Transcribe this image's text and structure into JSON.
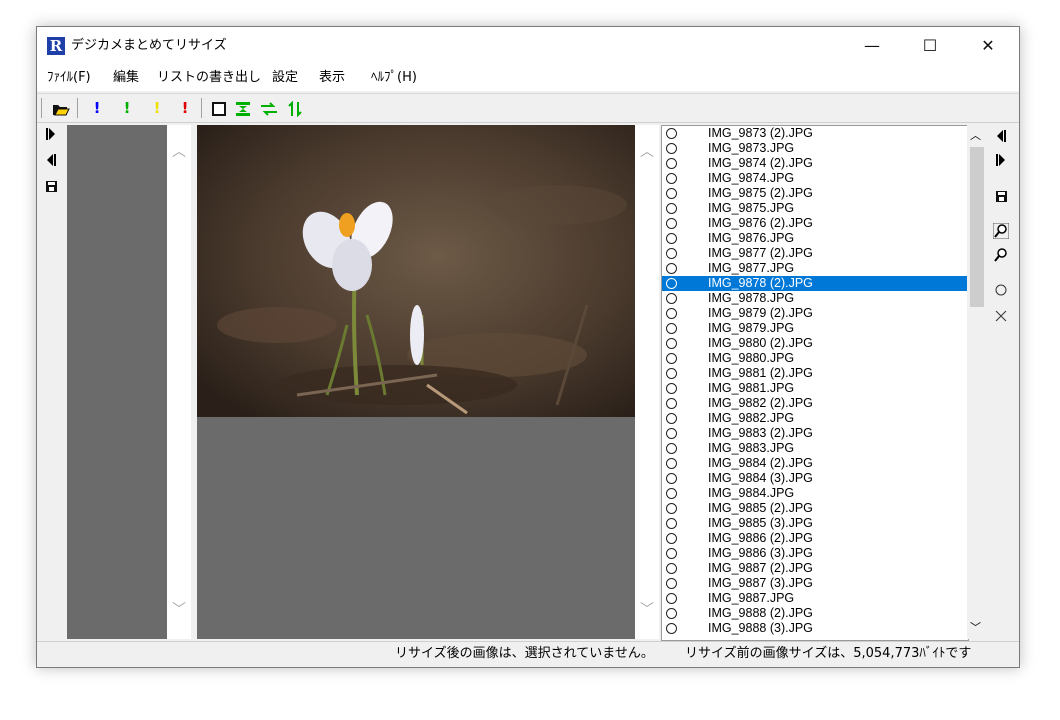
{
  "window": {
    "title": "デジカメまとめてリサイズ",
    "icon_letter": "R",
    "minimize": "—",
    "maximize": "☐",
    "close": "✕"
  },
  "menu": [
    {
      "label": "ﾌｧｲﾙ(F)"
    },
    {
      "label": "編集"
    },
    {
      "label": "リストの書き出し"
    },
    {
      "label": "設定"
    },
    {
      "label": "表示"
    },
    {
      "label": "ﾍﾙﾌﾟ(H)"
    }
  ],
  "toolbar": {
    "icons": [
      "open-folder-icon",
      "exclamation-blue-icon",
      "exclamation-green-icon",
      "exclamation-yellow-icon",
      "exclamation-red-icon",
      "square-icon",
      "fit-icon",
      "swap-icon",
      "updown-icon"
    ],
    "colors": {
      "blue": "#0000ff",
      "green": "#00b000",
      "yellow": "#f0e000",
      "red": "#e00000"
    }
  },
  "file_list": {
    "selected_index": 10,
    "items": [
      "IMG_9873 (2).JPG",
      "IMG_9873.JPG",
      "IMG_9874 (2).JPG",
      "IMG_9874.JPG",
      "IMG_9875 (2).JPG",
      "IMG_9875.JPG",
      "IMG_9876 (2).JPG",
      "IMG_9876.JPG",
      "IMG_9877 (2).JPG",
      "IMG_9877.JPG",
      "IMG_9878 (2).JPG",
      "IMG_9878.JPG",
      "IMG_9879 (2).JPG",
      "IMG_9879.JPG",
      "IMG_9880 (2).JPG",
      "IMG_9880.JPG",
      "IMG_9881 (2).JPG",
      "IMG_9881.JPG",
      "IMG_9882 (2).JPG",
      "IMG_9882.JPG",
      "IMG_9883 (2).JPG",
      "IMG_9883.JPG",
      "IMG_9884 (2).JPG",
      "IMG_9884 (3).JPG",
      "IMG_9884.JPG",
      "IMG_9885 (2).JPG",
      "IMG_9885 (3).JPG",
      "IMG_9886 (2).JPG",
      "IMG_9886 (3).JPG",
      "IMG_9887 (2).JPG",
      "IMG_9887 (3).JPG",
      "IMG_9887.JPG",
      "IMG_9888 (2).JPG",
      "IMG_9888 (3).JPG"
    ]
  },
  "status": {
    "left": "リサイズ後の画像は、選択されていません。",
    "right": "リサイズ前の画像サイズは、5,054,773ﾊﾞｲﾄです"
  },
  "colors": {
    "selection": "#0078d7",
    "panel_gray": "#6b6b6b",
    "window_bg": "#f0f0f0"
  }
}
